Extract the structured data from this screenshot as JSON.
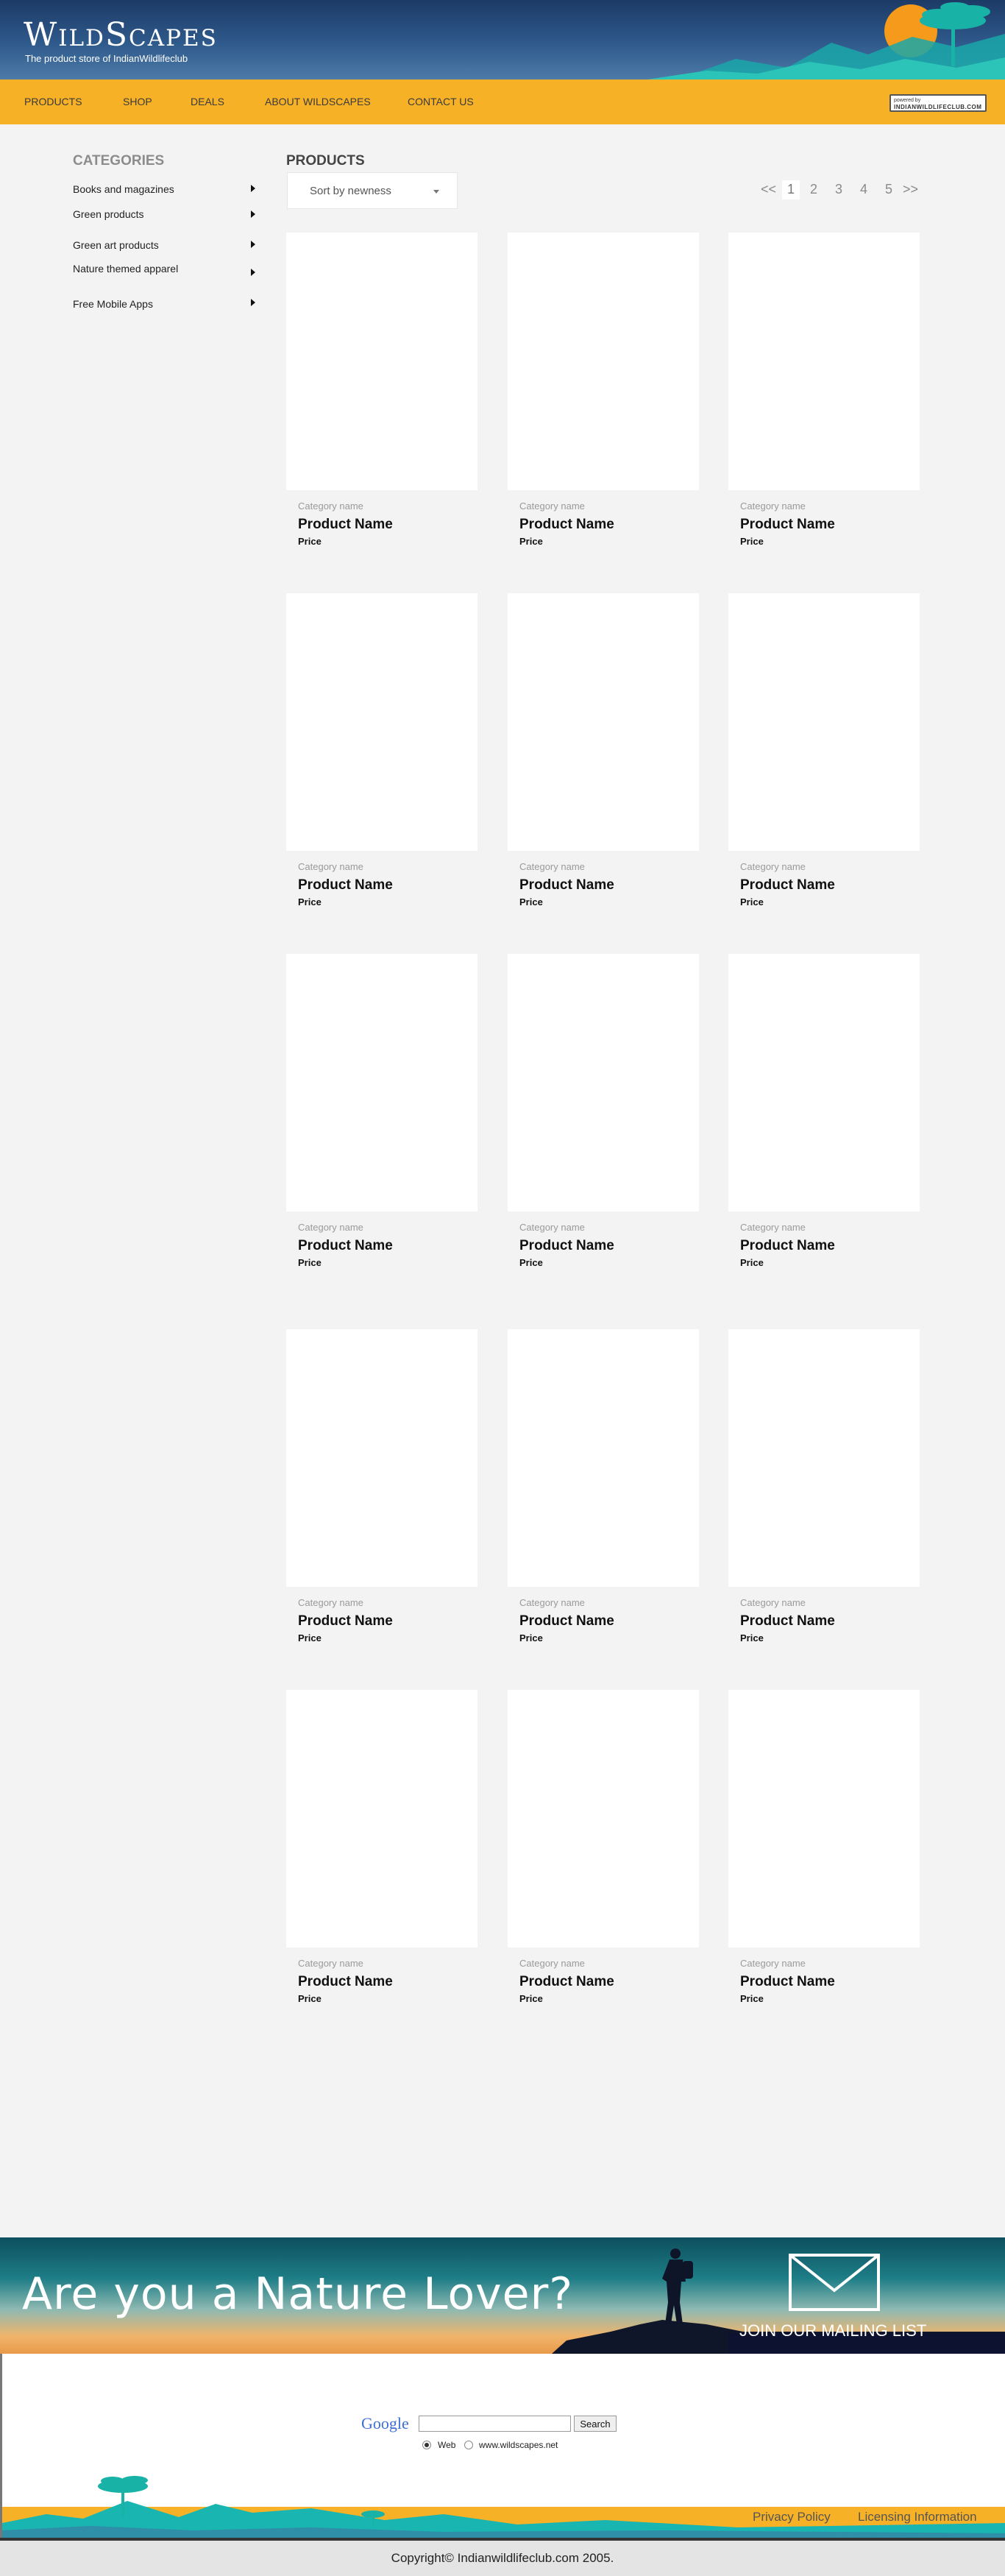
{
  "header": {
    "logo_title": "WildScapes",
    "logo_tagline": "The product store of IndianWildlifeclub"
  },
  "nav": {
    "items": [
      {
        "label": "Products"
      },
      {
        "label": "Shop"
      },
      {
        "label": "Deals"
      },
      {
        "label": "About Wildscapes"
      },
      {
        "label": "Contact us"
      }
    ],
    "powered_by_small": "powered by",
    "powered_by_name": "INDIANWILDLIFECLUB.COM"
  },
  "sidebar": {
    "heading": "CATEGORIES",
    "items": [
      {
        "label": "Books and magazines"
      },
      {
        "label": "Green products"
      },
      {
        "label": "Green art products"
      },
      {
        "label": "Nature themed apparel"
      },
      {
        "label": "Free Mobile Apps"
      }
    ]
  },
  "products": {
    "heading": "PRODUCTS",
    "sort_selected": "Sort by newness",
    "pagination": {
      "prev": "<<",
      "pages": [
        "1",
        "2",
        "3",
        "4",
        "5"
      ],
      "current": "1",
      "next": ">>"
    },
    "items": [
      {
        "category": "Category name",
        "name": "Product Name",
        "price": "Price"
      },
      {
        "category": "Category name",
        "name": "Product Name",
        "price": "Price"
      },
      {
        "category": "Category name",
        "name": "Product Name",
        "price": "Price"
      },
      {
        "category": "Category name",
        "name": "Product Name",
        "price": "Price"
      },
      {
        "category": "Category name",
        "name": "Product Name",
        "price": "Price"
      },
      {
        "category": "Category name",
        "name": "Product Name",
        "price": "Price"
      },
      {
        "category": "Category name",
        "name": "Product Name",
        "price": "Price"
      },
      {
        "category": "Category name",
        "name": "Product Name",
        "price": "Price"
      },
      {
        "category": "Category name",
        "name": "Product Name",
        "price": "Price"
      },
      {
        "category": "Category name",
        "name": "Product Name",
        "price": "Price"
      },
      {
        "category": "Category name",
        "name": "Product Name",
        "price": "Price"
      },
      {
        "category": "Category name",
        "name": "Product Name",
        "price": "Price"
      },
      {
        "category": "Category name",
        "name": "Product Name",
        "price": "Price"
      },
      {
        "category": "Category name",
        "name": "Product Name",
        "price": "Price"
      },
      {
        "category": "Category name",
        "name": "Product Name",
        "price": "Price"
      }
    ]
  },
  "banner": {
    "headline": "Are you a Nature Lover?",
    "mailing_list": "JOIN OUR MAILING LIST"
  },
  "search": {
    "logo": "Google",
    "input_value": "",
    "button_label": "Search",
    "option_web": "Web",
    "option_site": "www.wildscapes.net",
    "selected": "Web"
  },
  "footer": {
    "privacy": "Privacy Policy",
    "licensing": "Licensing Information",
    "copyright": "Copyright© Indianwildlifeclub.com 2005."
  },
  "colors": {
    "nav_bg": "#f7b126",
    "header_bg": "#1c3a66",
    "page_bg": "#f3f3f3",
    "sun": "#f59a1b",
    "hills": "#19b5b0"
  },
  "icons": [
    "sun-icon",
    "tree-icon",
    "chevron-right-icon",
    "chevron-down-icon",
    "envelope-icon",
    "hiker-silhouette-icon"
  ]
}
